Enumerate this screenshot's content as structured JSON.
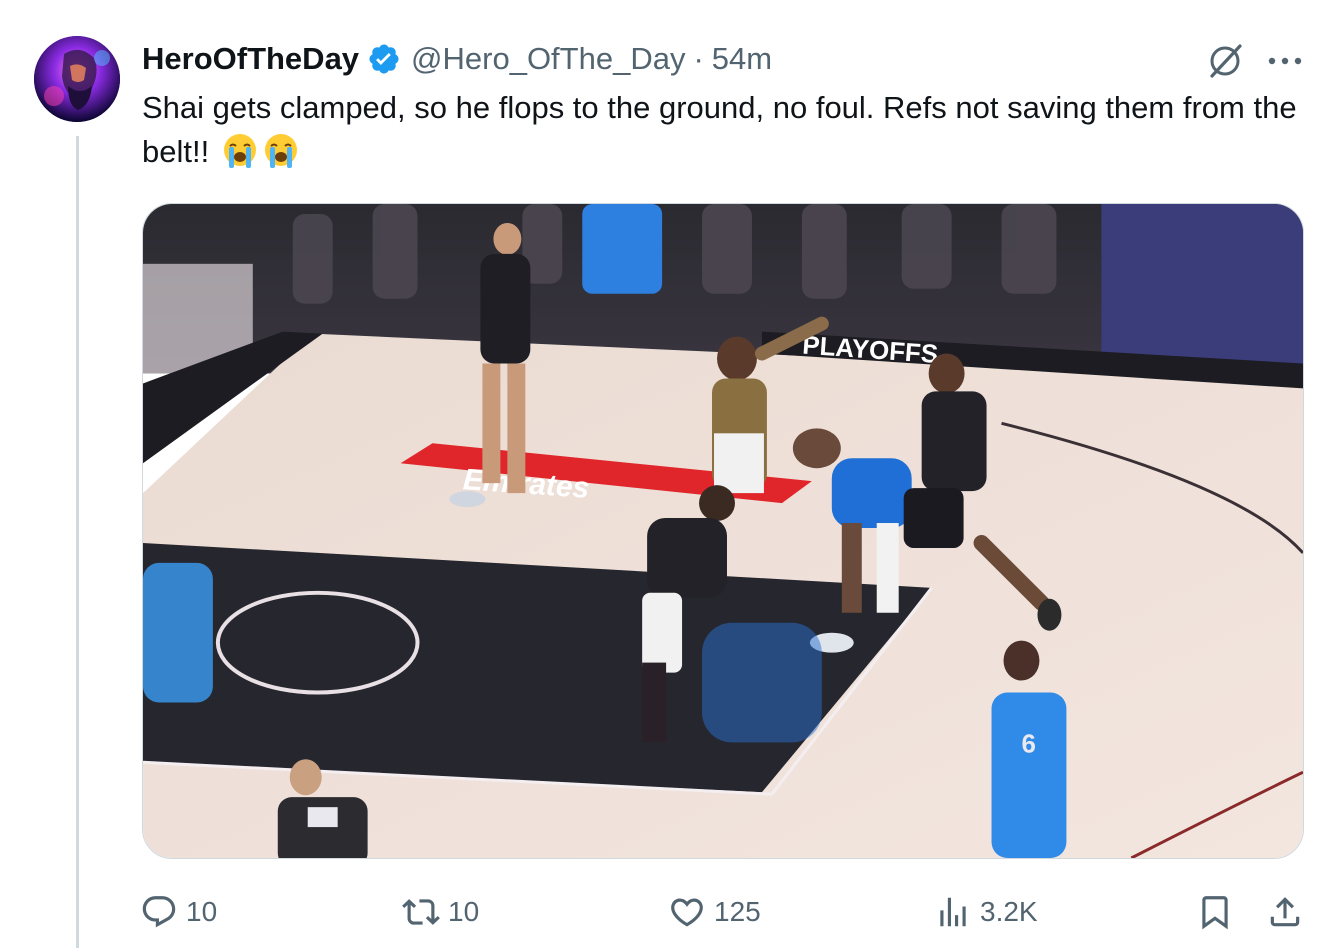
{
  "author": {
    "display_name": "HeroOfTheDay",
    "handle": "@Hero_OfThe_Day",
    "separator": "·",
    "timestamp": "54m",
    "verified": true
  },
  "tweet": {
    "text": "Shai gets clamped, so he flops to the ground, no foul. Refs not saving them from the belt!!",
    "emojis": [
      "loudly-crying-face",
      "loudly-crying-face"
    ]
  },
  "media": {
    "type": "video-still",
    "description_icon": "basketball-court-image",
    "court_text": "Emirates",
    "banner_text": "PLAYOFFS"
  },
  "actions": {
    "replies": "10",
    "reposts": "10",
    "likes": "125",
    "views": "3.2K"
  },
  "colors": {
    "accent": "#1d9bf0",
    "muted": "#536471",
    "text": "#0f1419",
    "border": "#cfd9de"
  },
  "icons": {
    "reply": "reply-icon",
    "repost": "repost-icon",
    "like": "heart-icon",
    "views": "views-icon",
    "bookmark": "bookmark-icon",
    "share": "share-icon",
    "grok": "grok-icon",
    "more": "more-icon"
  }
}
